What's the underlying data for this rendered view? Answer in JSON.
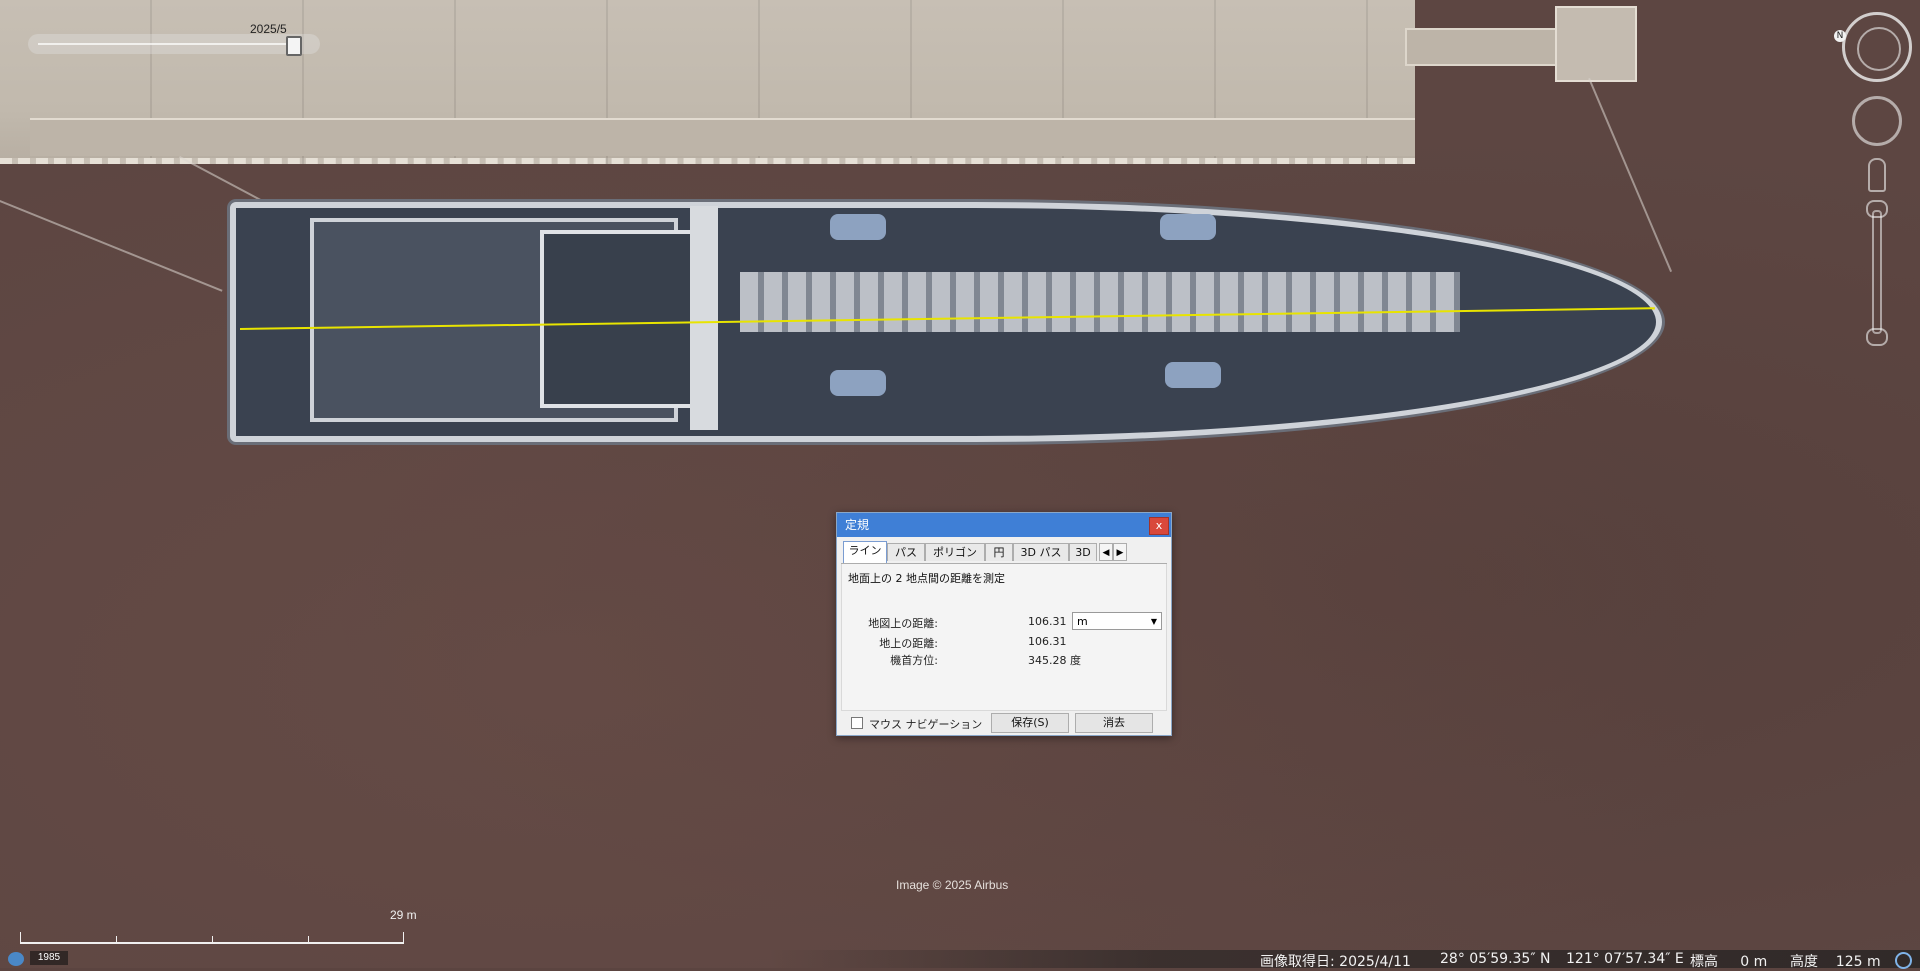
{
  "timeline": {
    "date_label": "2025/5"
  },
  "dialog": {
    "title": "定規",
    "close_label": "x",
    "tabs": [
      {
        "label": "ライン",
        "active": true
      },
      {
        "label": "パス"
      },
      {
        "label": "ポリゴン"
      },
      {
        "label": "円"
      },
      {
        "label": "3D パス"
      },
      {
        "label": "3D"
      }
    ],
    "tab_scroll_left": "◀",
    "tab_scroll_right": "▶",
    "description": "地面上の 2 地点間の距離を測定",
    "map_distance_label": "地図上の距離:",
    "map_distance_value": "106.31",
    "unit_selected": "m",
    "ground_distance_label": "地上の距離:",
    "ground_distance_value": "106.31",
    "heading_label": "機首方位:",
    "heading_value": "345.28 度",
    "mouse_nav_label": "マウス ナビゲーション",
    "mouse_nav_checked": false,
    "save_label": "保存(S)",
    "clear_label": "消去"
  },
  "attribution": "Image © 2025 Airbus",
  "scale": {
    "label": "29 m"
  },
  "status": {
    "year_badge": "1985",
    "imagery_date": "画像取得日: 2025/4/11",
    "latitude": "28° 05′59.35″ N",
    "longitude": "121° 07′57.34″ E",
    "elevation": "標高     0 m",
    "eye_alt": "高度    125 m"
  },
  "nav": {
    "north_label": "N"
  },
  "colors": {
    "measure_line": "#e8e400",
    "dialog_title": "#3f7fd6",
    "water": "#5d4642"
  }
}
